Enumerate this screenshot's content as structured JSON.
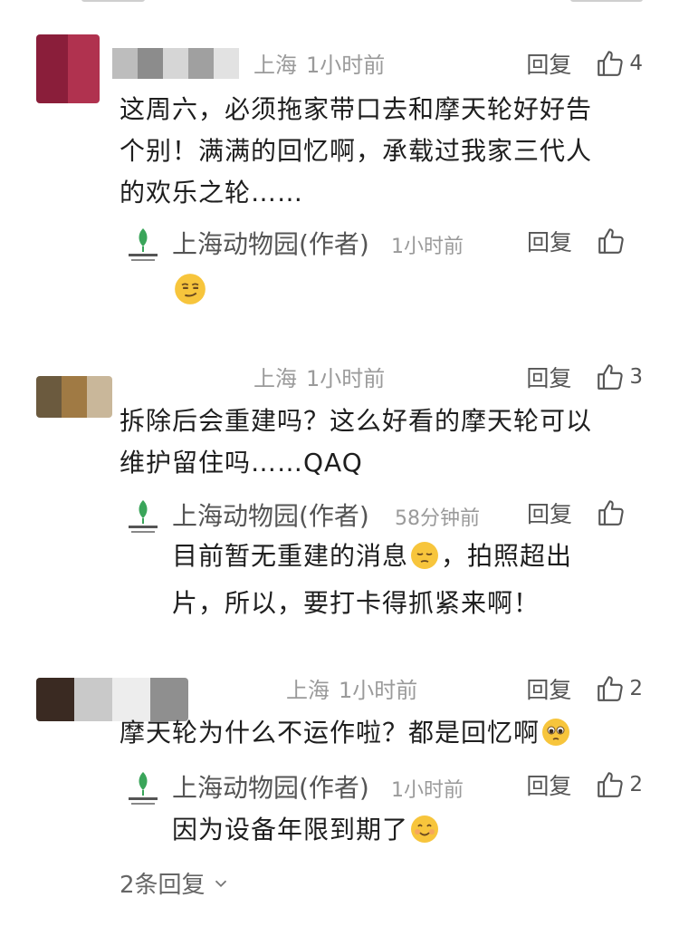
{
  "comments": [
    {
      "location": "上海",
      "time": "1小时前",
      "reply_label": "回复",
      "likes": "4",
      "text_lines": [
        "这周六，必须拖家带口去和摩天轮好好告",
        "个别！满满的回忆啊，承载过我家三代人",
        "的欢乐之轮……"
      ],
      "reply": {
        "author": "上海动物园(作者)",
        "time": "1小时前",
        "reply_label": "回复",
        "likes": "",
        "emoji": "smirk-face-emoji"
      }
    },
    {
      "location": "上海",
      "time": "1小时前",
      "reply_label": "回复",
      "likes": "3",
      "text_lines": [
        "拆除后会重建吗？这么好看的摩天轮可以",
        "维护留住吗……QAQ"
      ],
      "reply": {
        "author": "上海动物园(作者)",
        "time": "58分钟前",
        "reply_label": "回复",
        "likes": "",
        "line1": "目前暂无重建的消息",
        "line1_after": "，拍照超出",
        "line2": "片，所以，要打卡得抓紧来啊！",
        "emoji": "pensive-face-emoji"
      }
    },
    {
      "location": "上海",
      "time": "1小时前",
      "reply_label": "回复",
      "likes": "2",
      "text": "摩天轮为什么不运作啦？都是回忆啊",
      "emoji": "pleading-face-emoji",
      "reply": {
        "author": "上海动物园(作者)",
        "time": "1小时前",
        "reply_label": "回复",
        "likes": "2",
        "text": "因为设备年限到期了",
        "emoji": "smiling-face-emoji"
      }
    }
  ],
  "more_replies": "2条回复",
  "icons": [
    "thumbs-up-icon",
    "chevron-down-icon",
    "zoo-logo-icon"
  ],
  "colors": {
    "text": "#1e1e1e",
    "meta": "#9a9a9a",
    "logo": "#3aa55a",
    "emoji": "#f7c53c"
  }
}
